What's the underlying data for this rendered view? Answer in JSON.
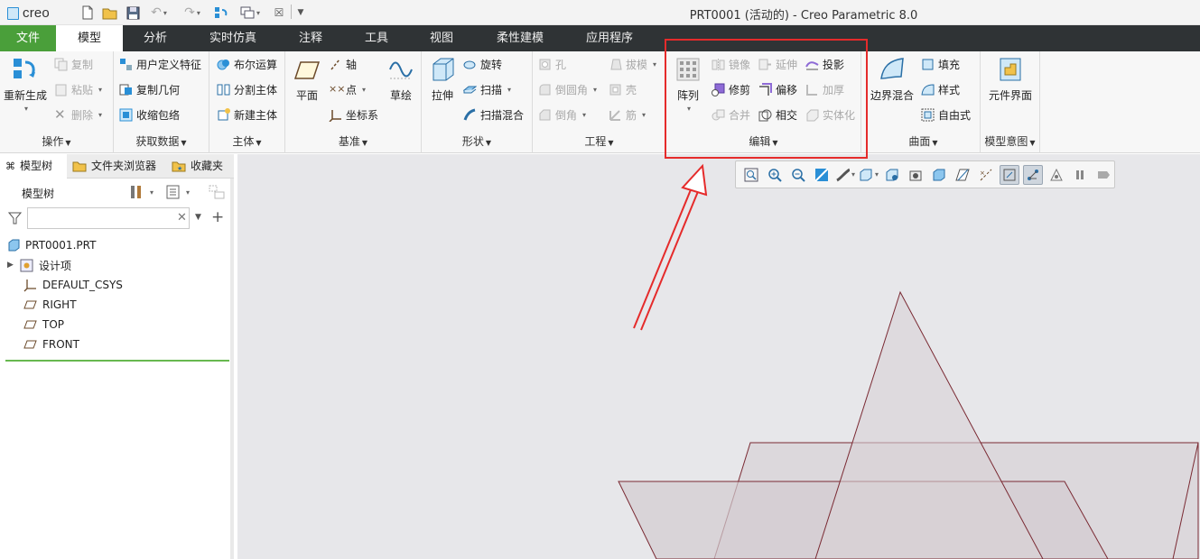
{
  "window": {
    "logo_text": "creo",
    "title": "PRT0001 (活动的) - Creo Parametric 8.0"
  },
  "quick_access": {
    "icons": [
      "new-icon",
      "open-icon",
      "save-icon",
      "undo-icon",
      "redo-icon",
      "regenerate-icon",
      "windows-icon",
      "close-window-icon",
      "customize-icon"
    ]
  },
  "tabs": [
    {
      "label": "文件"
    },
    {
      "label": "模型"
    },
    {
      "label": "分析"
    },
    {
      "label": "实时仿真"
    },
    {
      "label": "注释"
    },
    {
      "label": "工具"
    },
    {
      "label": "视图"
    },
    {
      "label": "柔性建模"
    },
    {
      "label": "应用程序"
    }
  ],
  "ribbon": {
    "operations": {
      "regenerate": "重新生成",
      "copy": "复制",
      "paste": "粘贴",
      "delete": "删除",
      "label": "操作"
    },
    "get_data": {
      "udf": "用户定义特征",
      "copy_geom": "复制几何",
      "shrinkwrap": "收缩包络",
      "label": "获取数据"
    },
    "body": {
      "boolean": "布尔运算",
      "split": "分割主体",
      "new_body": "新建主体",
      "label": "主体"
    },
    "datum": {
      "plane": "平面",
      "axis": "轴",
      "point": "点",
      "csys": "坐标系",
      "sketch": "草绘",
      "label": "基准"
    },
    "shapes": {
      "extrude": "拉伸",
      "revolve": "旋转",
      "sweep": "扫描",
      "swept_blend": "扫描混合",
      "label": "形状"
    },
    "engineering": {
      "hole": "孔",
      "round": "倒圆角",
      "chamfer": "倒角",
      "draft": "拔模",
      "shell": "壳",
      "rib": "筋",
      "label": "工程"
    },
    "editing": {
      "pattern": "阵列",
      "mirror": "镜像",
      "extend": "延伸",
      "project": "投影",
      "trim": "修剪",
      "offset": "偏移",
      "thicken": "加厚",
      "merge": "合并",
      "intersect": "相交",
      "solidify": "实体化",
      "label": "编辑"
    },
    "surfaces": {
      "boundary_blend": "边界混合",
      "fill": "填充",
      "style": "样式",
      "freestyle": "自由式",
      "label": "曲面"
    },
    "model_intent": {
      "component_interface": "元件界面",
      "label": "模型意图"
    }
  },
  "left_panel": {
    "tabs": [
      {
        "label": "模型树"
      },
      {
        "label": "文件夹浏览器"
      },
      {
        "label": "收藏夹"
      }
    ],
    "tree_title": "模型树",
    "filter_placeholder": "",
    "items": [
      {
        "label": "PRT0001.PRT",
        "icon": "part-icon"
      },
      {
        "label": "设计项",
        "icon": "design-items-icon"
      },
      {
        "label": "DEFAULT_CSYS",
        "icon": "csys-icon"
      },
      {
        "label": "RIGHT",
        "icon": "datum-plane-icon"
      },
      {
        "label": "TOP",
        "icon": "datum-plane-icon"
      },
      {
        "label": "FRONT",
        "icon": "datum-plane-icon"
      }
    ]
  },
  "graphics_toolbar": {
    "icons": [
      "refit-icon",
      "zoom-in-icon",
      "zoom-out-icon",
      "repaint-icon",
      "display-style-icon",
      "saved-orientations-icon",
      "view-manager-icon",
      "perspective-icon",
      "section-icon",
      "plane-display-icon",
      "axis-display-icon",
      "point-display-icon",
      "csys-display-icon",
      "spin-center-icon",
      "annotation-display-icon",
      "pause-icon",
      "next-icon"
    ]
  },
  "colors": {
    "file_tab": "#4a9f3a",
    "tab_bar": "#2f3335",
    "highlight": "#e52b2b",
    "tree_separator": "#67b84f",
    "plane_edge": "#7a2a33"
  }
}
